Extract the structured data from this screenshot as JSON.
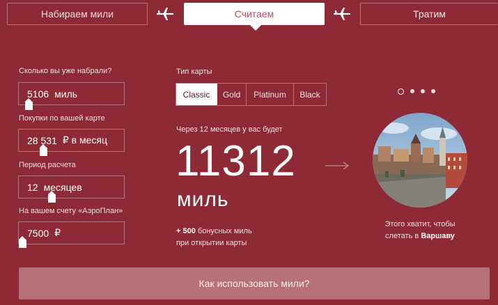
{
  "steps": [
    {
      "label": "Набираем мили"
    },
    {
      "label": "Считаем"
    },
    {
      "label": "Тратим"
    }
  ],
  "inputs": {
    "miles": {
      "label": "Сколько вы уже набрали?",
      "value": "5106",
      "unit": "миль"
    },
    "purchases": {
      "label": "Покупки по вашей карте",
      "value": "28 531",
      "unit": "₽ в месяц"
    },
    "period": {
      "label": "Период расчета",
      "value": "12",
      "unit": "месяцев"
    },
    "account": {
      "label": "На вашем счету «АэроПлан»",
      "value": "7500",
      "unit": "₽"
    }
  },
  "card_type": {
    "label": "Тип карты",
    "options": [
      "Classic",
      "Gold",
      "Platinum",
      "Black"
    ],
    "selected": "Classic"
  },
  "result": {
    "label": "Через 12 месяцев у вас будет",
    "value": "11312",
    "unit": "миль",
    "bonus_value": "+ 500",
    "bonus_text": "бонусных миль",
    "bonus_text2": "при открытии карты"
  },
  "destination": {
    "line1": "Этого хватит, чтобы",
    "line2_prefix": "слетать в",
    "city": "Варшаву"
  },
  "carousel": {
    "active_index": 0,
    "count": 4
  },
  "cta": {
    "label": "Как использовать мили?"
  },
  "colors": {
    "background": "#8e2a35",
    "accent": "#c0485a",
    "cta": "#b6727a"
  }
}
